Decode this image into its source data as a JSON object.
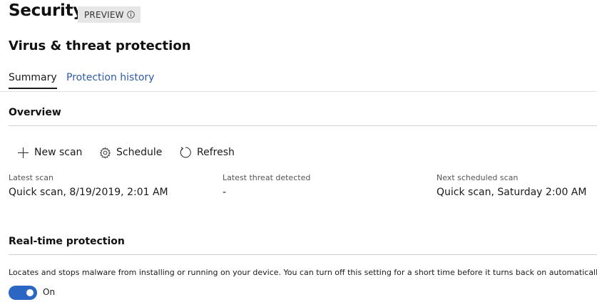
{
  "header": {
    "title": "Security",
    "badge": "PREVIEW",
    "badge_icon": "info-icon"
  },
  "section": {
    "title": "Virus & threat protection"
  },
  "tabs": [
    {
      "label": "Summary",
      "active": true
    },
    {
      "label": "Protection history",
      "active": false
    }
  ],
  "overview": {
    "heading": "Overview",
    "toolbar": {
      "new_scan": "New scan",
      "schedule": "Schedule",
      "refresh": "Refresh"
    },
    "stats": [
      {
        "label": "Latest scan",
        "value": "Quick scan, 8/19/2019, 2:01 AM"
      },
      {
        "label": "Latest threat detected",
        "value": "-"
      },
      {
        "label": "Next scheduled scan",
        "value": "Quick scan, Saturday 2:00 AM"
      }
    ]
  },
  "realtime": {
    "heading": "Real-time protection",
    "description": "Locates and stops malware from installing or running on your device. You can turn off this setting for a short time before it turns back on automatically.",
    "toggle_on": true,
    "toggle_label": "On"
  },
  "colors": {
    "accent": "#2b66c4",
    "link": "#2e5ba7",
    "badge_bg": "#e6e6e6"
  }
}
